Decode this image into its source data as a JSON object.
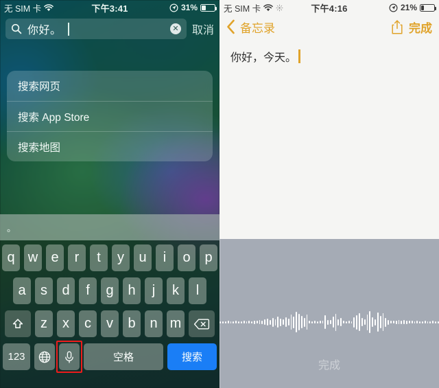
{
  "left_screen": {
    "status_bar": {
      "carrier": "无 SIM 卡",
      "wifi_icon": "wifi-icon",
      "time": "下午3:41",
      "location_icon": "location-arrow-icon",
      "battery_percent": "31%",
      "battery_level": 31
    },
    "search": {
      "icon": "search-icon",
      "value": "你好。",
      "placeholder": "搜索",
      "clear_label": "✕",
      "cancel_label": "取消"
    },
    "suggestions": [
      {
        "label": "搜索网页"
      },
      {
        "label": "搜索 App Store"
      },
      {
        "label": "搜索地图"
      }
    ],
    "predictive_bar": {
      "candidate": "。"
    },
    "keyboard": {
      "row1": [
        "q",
        "w",
        "e",
        "r",
        "t",
        "y",
        "u",
        "i",
        "o",
        "p"
      ],
      "row2": [
        "a",
        "s",
        "d",
        "f",
        "g",
        "h",
        "j",
        "k",
        "l"
      ],
      "row3": [
        "z",
        "x",
        "c",
        "v",
        "b",
        "n",
        "m"
      ],
      "shift_icon": "shift-up-arrow-icon",
      "backspace_icon": "backspace-delete-icon",
      "numbers_label": "123",
      "globe_icon": "globe-language-icon",
      "mic_icon": "microphone-icon",
      "space_label": "空格",
      "search_label": "搜索",
      "highlight_color": "#ee1c1c",
      "search_key_color": "#1a7ef6"
    }
  },
  "right_screen": {
    "status_bar": {
      "carrier": "无 SIM 卡",
      "wifi_icon": "wifi-icon",
      "sync_icon": "sync-activity-icon",
      "time": "下午4:16",
      "location_icon": "location-arrow-icon",
      "battery_percent": "21%",
      "battery_level": 21
    },
    "nav_bar": {
      "back_icon": "chevron-left-icon",
      "back_label": "备忘录",
      "share_icon": "share-upload-icon",
      "done_label": "完成",
      "accent_color": "#e0a32a"
    },
    "note": {
      "text": "你好，今天。"
    },
    "dictation": {
      "done_label": "完成",
      "background_color": "#a5abb5",
      "waveform": [
        3,
        3,
        3,
        4,
        3,
        3,
        4,
        3,
        3,
        4,
        3,
        4,
        3,
        5,
        4,
        6,
        5,
        8,
        10,
        7,
        13,
        9,
        16,
        11,
        8,
        14,
        10,
        22,
        17,
        30,
        24,
        18,
        13,
        22,
        4,
        3,
        4,
        3,
        4,
        4,
        20,
        7,
        6,
        16,
        25,
        9,
        12,
        4,
        3,
        4,
        3,
        15,
        21,
        26,
        12,
        8,
        23,
        32,
        14,
        9,
        28,
        18,
        26,
        13,
        7,
        4,
        4,
        5,
        6,
        5,
        6,
        5,
        4,
        4,
        3,
        4,
        3,
        3,
        4,
        3,
        3,
        4,
        3,
        3
      ]
    }
  }
}
